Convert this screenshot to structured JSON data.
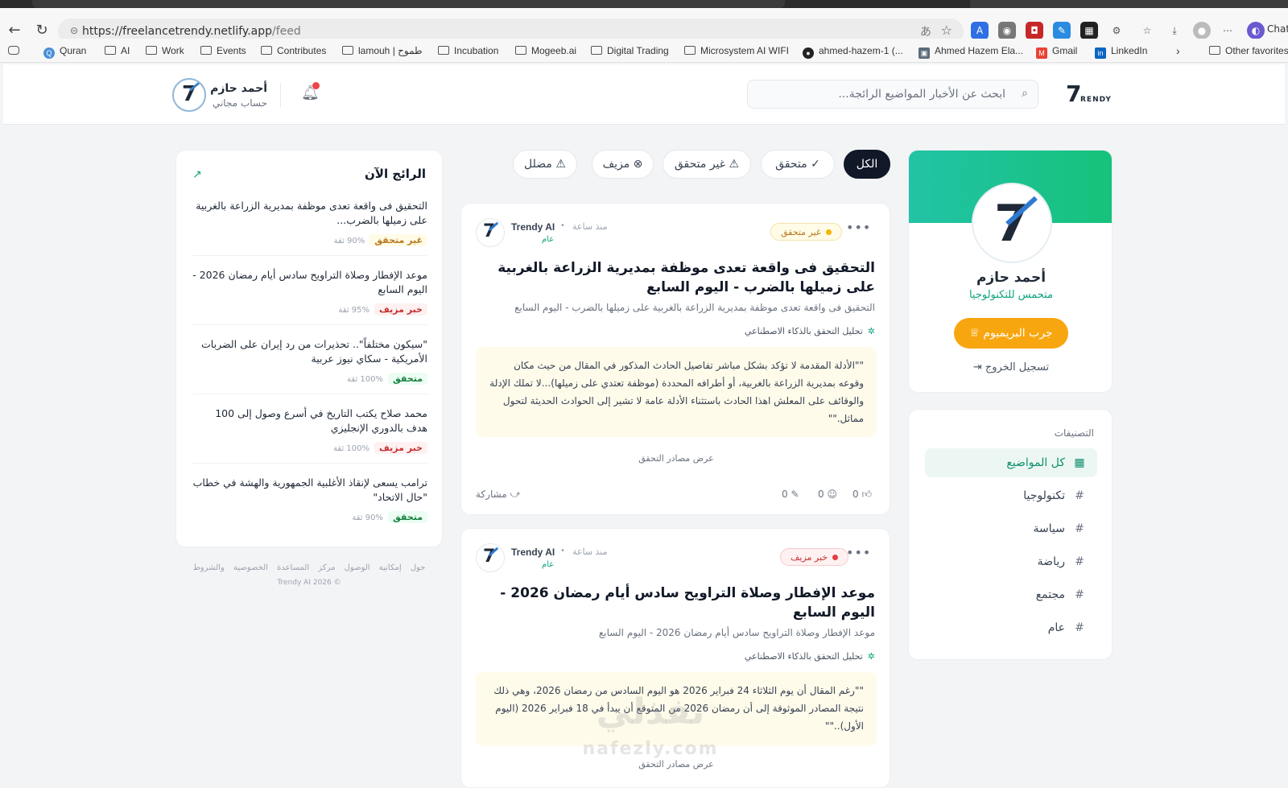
{
  "browser": {
    "url_host": "https://freelancetrendy.netlify.app",
    "url_path": "/feed",
    "chat_label": "Chat",
    "bookmarks": [
      "Quran",
      "AI",
      "Work",
      "Events",
      "Contributes",
      "lamouh | طموح",
      "Incubation",
      "Mogeeb.ai",
      "Digital Trading",
      "Microsystem AI WIFI",
      "ahmed-hazem-1 (...",
      "Ahmed Hazem Ela...",
      "Gmail",
      "LinkedIn"
    ],
    "other_favorites": "Other favorites"
  },
  "header": {
    "logo_text": "RENDY",
    "search_placeholder": "ابحث عن الأخبار المواضيع الرائجة...",
    "user_name": "أحمد حازم",
    "user_plan": "حساب مجاني"
  },
  "profile": {
    "name": "أحمد حازم",
    "title": "متحمس للتكنولوجيا",
    "premium_label": "جرب البريميوم",
    "logout_label": "تسجيل الخروج"
  },
  "categories": {
    "title": "التصنيفات",
    "items": [
      "كل المواضيع",
      "تكنولوجيا",
      "سياسة",
      "رياضة",
      "مجتمع",
      "عام"
    ]
  },
  "filters": [
    "الكل",
    "متحقق",
    "غير متحقق",
    "مزيف",
    "مضلل"
  ],
  "posts": [
    {
      "author": "Trendy AI",
      "time": "منذ ساعة",
      "category": "عام",
      "badge": "غير متحقق",
      "title": "التحقيق فى واقعة تعدى موظفة بمديرية الزراعة بالغربية على زميلها بالضرب - اليوم السابع",
      "subtitle": "التحقيق فى واقعة تعدى موظفة بمديرية الزراعة بالغربية على زميلها بالضرب - اليوم السابع",
      "ai_label": "تحليل التحقق بالذكاء الاصطناعي",
      "analysis": "\"\"الأدلة المقدمة لا تؤكد بشكل مباشر تفاصيل الحادث المذكور في المقال من حيث مكان وقوعه بمديرية الزراعة بالغربية، أو أطرافه المحددة (موظفة تعتدي على زميلها)...لا تملك الإدلة والوقائف على المعلش اهذا الحادث باستثناء الأدلة عامة لا تشير إلى الحوادث الحديثة لتحول مماثل.\"\"",
      "sources_label": "عرض مصادر التحقق",
      "likes": "0",
      "neutral": "0",
      "dislikes": "0",
      "share_label": "مشاركة"
    },
    {
      "author": "Trendy AI",
      "time": "منذ ساعة",
      "category": "عام",
      "badge": "خبر مزيف",
      "title": "موعد الإفطار وصلاة التراويح سادس أيام رمضان 2026 - اليوم السابع",
      "subtitle": "موعد الإفطار وصلاة التراويح سادس أيام رمضان 2026 - اليوم السابع",
      "ai_label": "تحليل التحقق بالذكاء الاصطناعي",
      "analysis": "\"\"رغم المقال أن يوم الثلاثاء 24 فبراير 2026 هو اليوم السادس من رمضان 2026، وهي ذلك نتيجة المصادر الموثوقة إلى أن رمضان 2026 من المتوقع أن يبدأ في 18 فبراير 2026 (اليوم الأول)..\"\"",
      "sources_label": "عرض مصادر التحقق"
    }
  ],
  "trending": {
    "title": "الرائج الآن",
    "items": [
      {
        "title": "التحقيق فى واقعة تعدى موظفة بمديرية الزراعة بالغربية على زميلها بالضرب...",
        "badge": "غير متحقق",
        "kind": "unv",
        "conf": "90% ثقة"
      },
      {
        "title": "موعد الإفطار وصلاة التراويح سادس أيام رمضان 2026 - اليوم السابع",
        "badge": "خبر مزيف",
        "kind": "fake",
        "conf": "95% ثقة"
      },
      {
        "title": "\"سيكون مختلفاً\".. تحذيرات من رد إيران على الضربات الأمريكية - سكاي نيوز عربية",
        "badge": "متحقق",
        "kind": "ver",
        "conf": "100% ثقة"
      },
      {
        "title": "محمد صلاح يكتب التاريخ في أسرع وصول إلى 100 هدف بالدوري الإنجليزي",
        "badge": "خبر مزيف",
        "kind": "fake",
        "conf": "100% ثقة"
      },
      {
        "title": "ترامب يسعى لإنقاذ الأغلبية الجمهورية والهشة في خطاب \"حال الاتحاد\"",
        "badge": "متحقق",
        "kind": "ver",
        "conf": "90% ثقة"
      }
    ]
  },
  "footer": {
    "links": [
      "حول",
      "إمكانية الوصول",
      "مركز المساعدة",
      "الخصوصية والشروط"
    ],
    "copyright": "Trendy AI 2026 ©"
  },
  "watermark": {
    "ar": "نفذلي",
    "en": "nafezly.com"
  },
  "colors": {
    "accent": "#10a37f",
    "premium": "#f8a60f",
    "fake": "#e53e3e",
    "unverified": "#f4b400",
    "dark": "#111827"
  }
}
